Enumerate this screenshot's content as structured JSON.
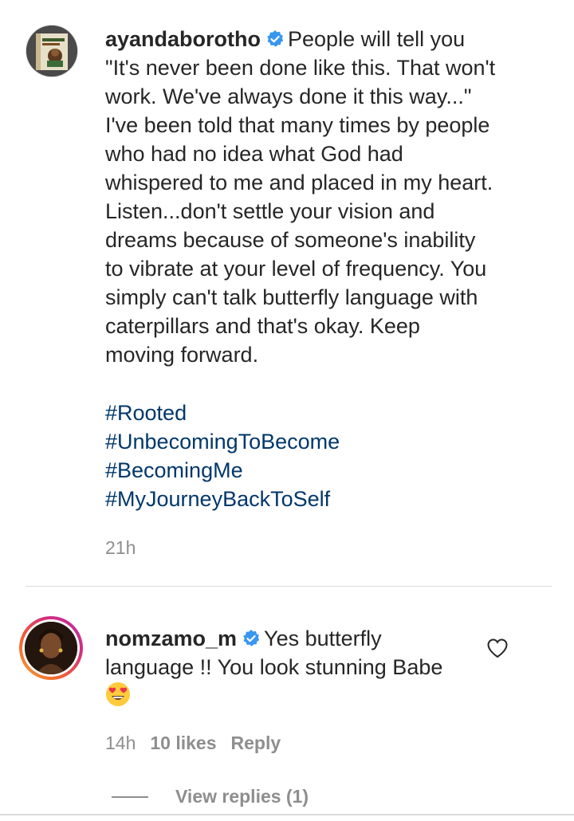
{
  "main_comment": {
    "username": "ayandaborotho",
    "verified": true,
    "text_lines": [
      "People will tell you",
      "\"It's never been done like this. That won't",
      "work. We've always done it this way...\"",
      "I've been told that many times by people",
      "who had no idea what God had",
      "whispered to me and placed in my heart.",
      "Listen...don't settle your vision and",
      "dreams because of someone's inability",
      "to vibrate at your level of frequency. You",
      "simply can't talk butterfly language with",
      "caterpillars and that's okay. Keep",
      "moving forward."
    ],
    "hashtags": [
      "#Rooted",
      "#UnbecomingToBecome",
      "#BecomingMe",
      "#MyJourneyBackToSelf"
    ],
    "time": "21h",
    "avatar_icon": "book-cover-avatar"
  },
  "reply": {
    "username": "nomzamo_m",
    "verified": true,
    "text_line1": "Yes butterfly",
    "text_line2": "language !! You look stunning Babe",
    "emoji": "heart-eyes-emoji",
    "time": "14h",
    "likes": "10 likes",
    "reply_label": "Reply",
    "like_icon": "heart-outline-icon",
    "avatar_icon": "profile-photo-avatar"
  },
  "view_replies": {
    "label": "View replies (1)"
  },
  "colors": {
    "text": "#262626",
    "meta": "#8e8e8e",
    "hashtag": "#00376b",
    "verified": "#3897f0",
    "divider": "#dbdbdb"
  }
}
